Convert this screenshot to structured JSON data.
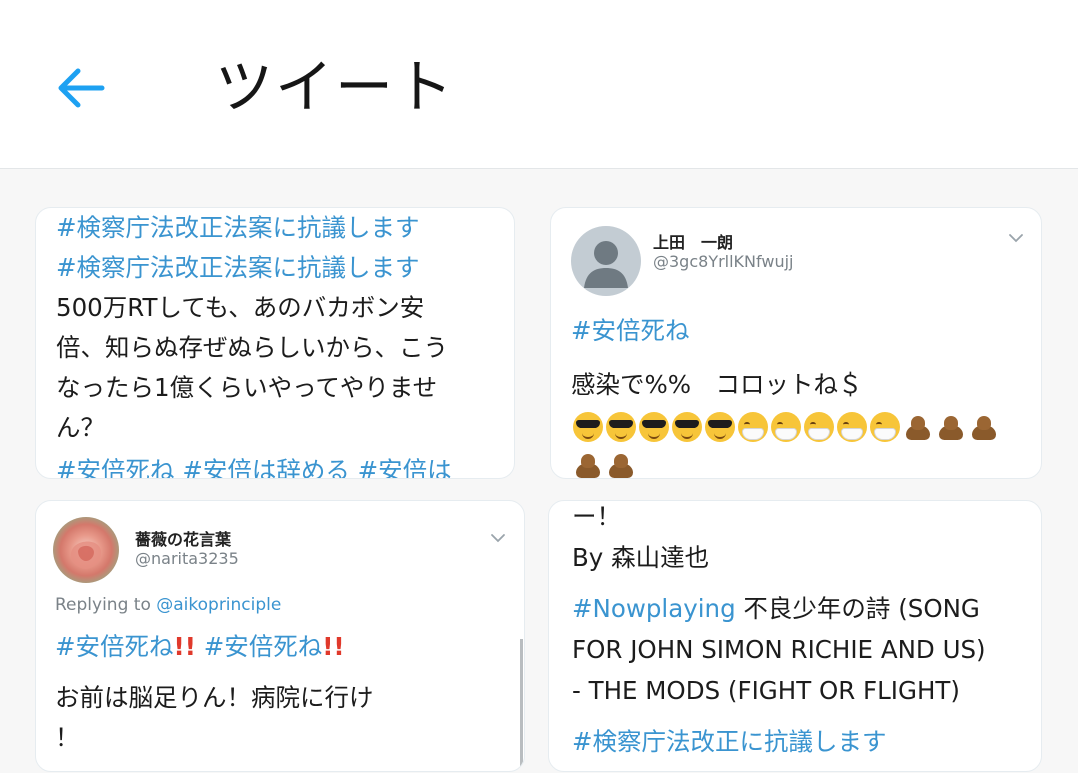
{
  "header": {
    "title": "ツイート",
    "back_icon": "arrow-left-icon",
    "accent_color": "#1da1f2"
  },
  "card_top_left": {
    "lines": [
      "#検察庁法改正法案に抗議します",
      "#検察庁法改正法案に抗議します",
      "500万RTしても、あのバカボン安",
      "倍、知らぬ存ぜぬらしいから、こう",
      "なったら1億くらいやってやりませ",
      "ん？",
      "#安倍死ね #安倍は辞める #安倍は"
    ]
  },
  "card_top_right": {
    "name": "上田　一朗",
    "handle": "@3gc8YrllKNfwujj",
    "hashtag": "#安倍死ね",
    "text": "感染で%%　コロットね＄",
    "emoji_row1": [
      "sunglasses-face-icon",
      "sunglasses-face-icon",
      "sunglasses-face-icon",
      "sunglasses-face-icon",
      "sunglasses-face-icon",
      "mask-face-icon",
      "mask-face-icon",
      "mask-face-icon",
      "mask-face-icon",
      "mask-face-icon",
      "poop-icon",
      "poop-icon",
      "poop-icon"
    ],
    "emoji_row2": [
      "poop-icon",
      "poop-icon"
    ]
  },
  "card_bottom_left": {
    "name": "薔薇の花言葉",
    "handle": "@narita3235",
    "replying_prefix": "Replying to",
    "replying_handle": "@aikoprinciple",
    "hashtag1": "#安倍死ね",
    "hashtag2": "#安倍死ね",
    "exclaim": "!!",
    "text_line1": "お前は脳足りん！病院に行け",
    "text_line2": "！"
  },
  "card_bottom_right": {
    "line1": "ー！",
    "line2": "By 森山達也",
    "nowplaying_tag": "#Nowplaying",
    "line3_rest": " 不良少年の詩 (SONG",
    "line4": "FOR JOHN SIMON RICHIE AND US)",
    "line5": "- THE MODS (FIGHT OR FLIGHT)",
    "line6": "#検察庁法改正に抗議します"
  }
}
